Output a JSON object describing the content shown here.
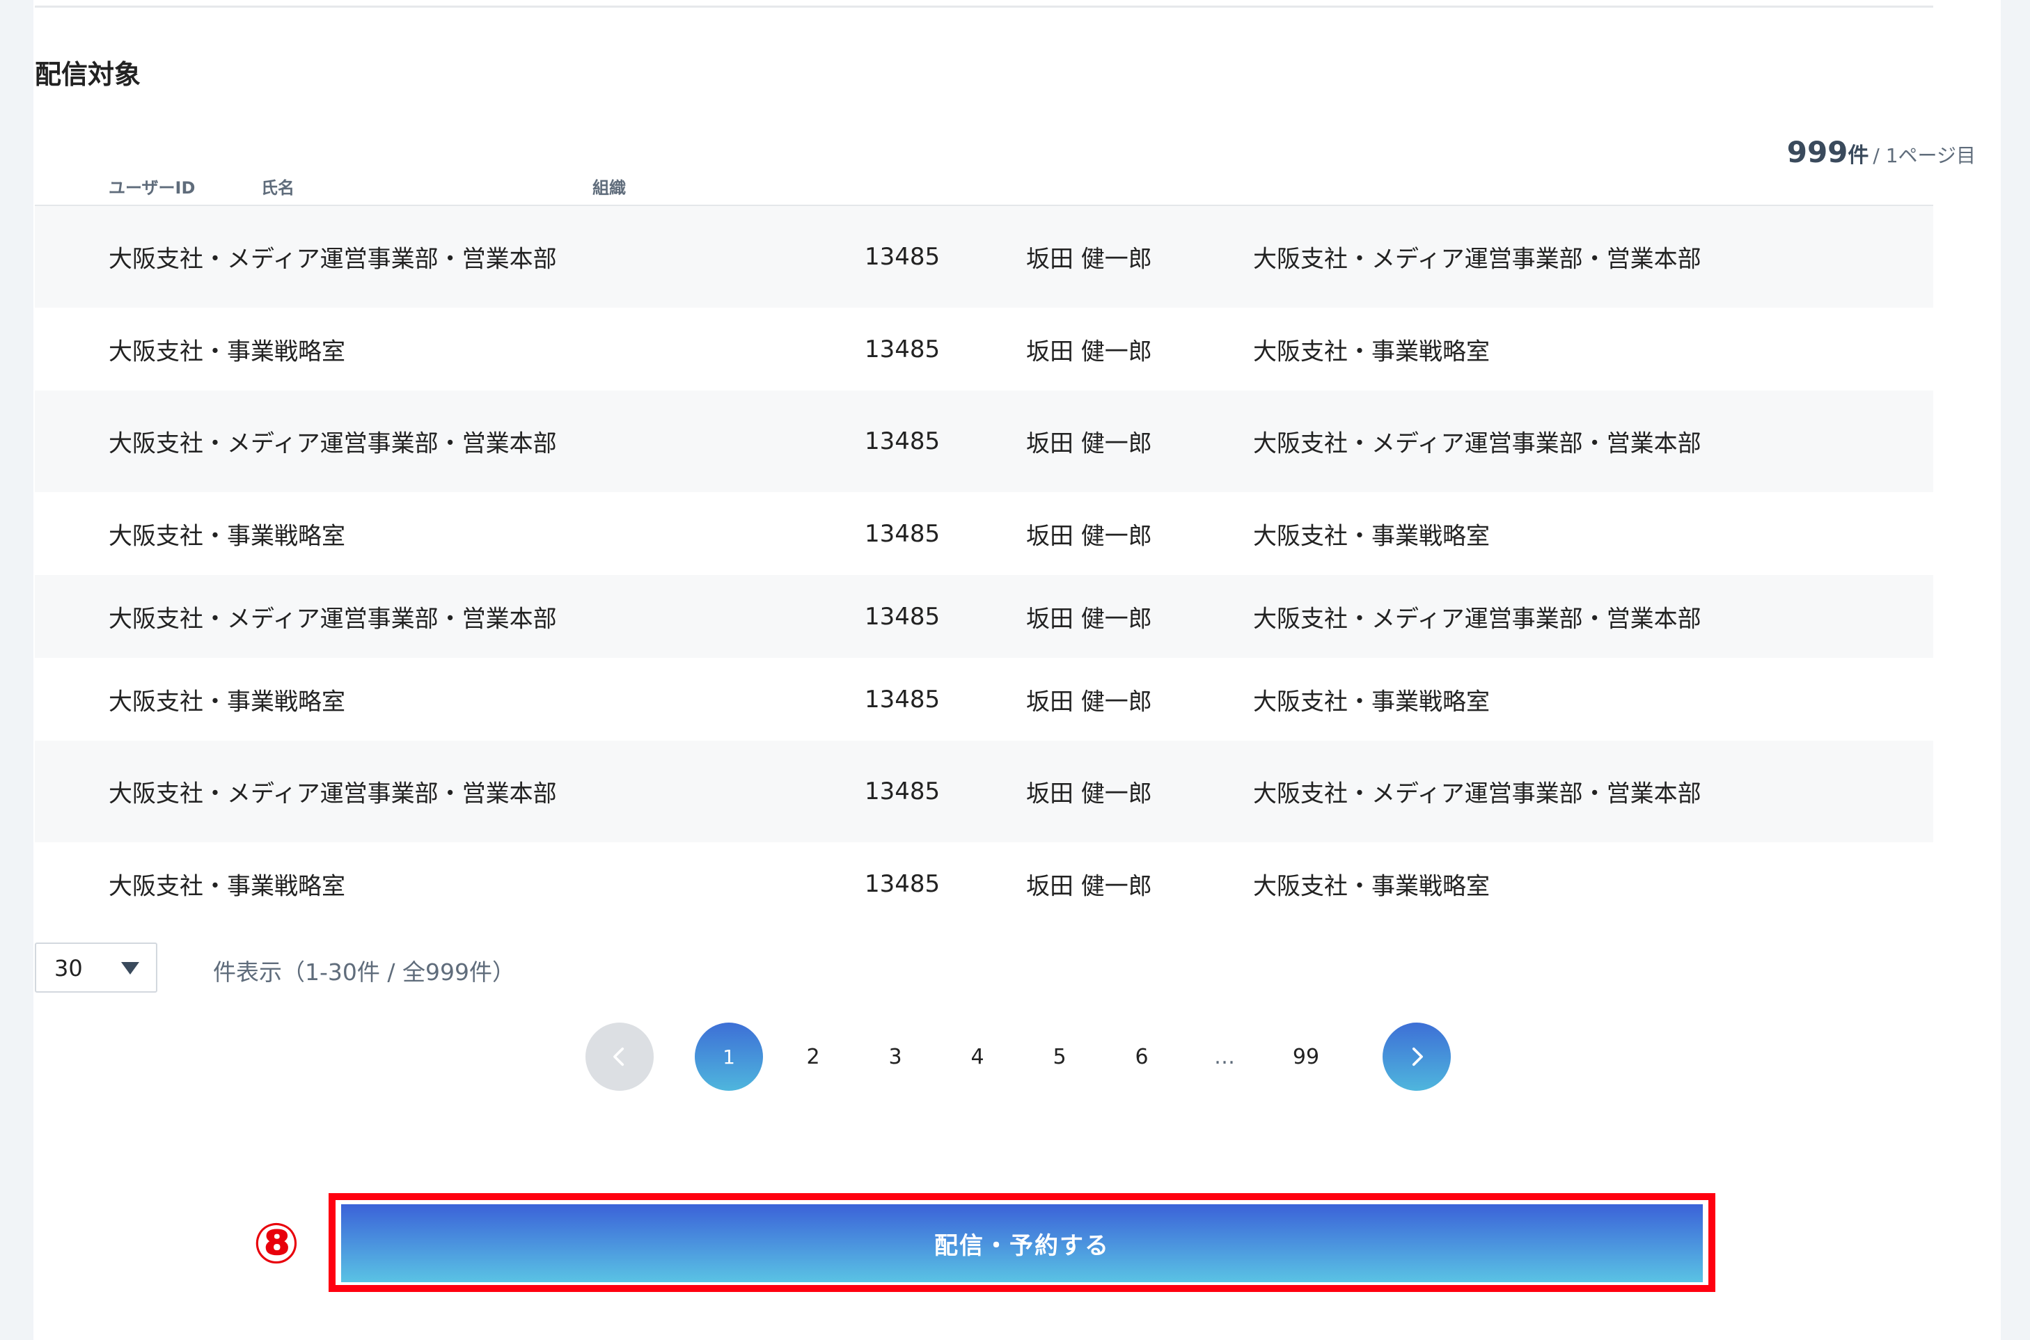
{
  "section": {
    "title": "配信対象"
  },
  "summary": {
    "count": "999",
    "unit": "件",
    "page_info": "/ 1ページ目"
  },
  "columns": [
    "ユーザーID",
    "氏名",
    "組織"
  ],
  "rows": [
    {
      "org_left": "大阪支社・メディア運営事業部・営業本部",
      "id": "13485",
      "name": "坂田 健一郎",
      "org": "大阪支社・メディア運営事業部・営業本部"
    },
    {
      "org_left": "大阪支社・事業戦略室",
      "id": "13485",
      "name": "坂田 健一郎",
      "org": "大阪支社・事業戦略室"
    },
    {
      "org_left": "大阪支社・メディア運営事業部・営業本部",
      "id": "13485",
      "name": "坂田 健一郎",
      "org": "大阪支社・メディア運営事業部・営業本部"
    },
    {
      "org_left": "大阪支社・事業戦略室",
      "id": "13485",
      "name": "坂田 健一郎",
      "org": "大阪支社・事業戦略室"
    },
    {
      "org_left": "大阪支社・メディア運営事業部・営業本部",
      "id": "13485",
      "name": "坂田 健一郎",
      "org": "大阪支社・メディア運営事業部・営業本部"
    },
    {
      "org_left": "大阪支社・事業戦略室",
      "id": "13485",
      "name": "坂田 健一郎",
      "org": "大阪支社・事業戦略室"
    },
    {
      "org_left": "大阪支社・メディア運営事業部・営業本部",
      "id": "13485",
      "name": "坂田 健一郎",
      "org": "大阪支社・メディア運営事業部・営業本部"
    },
    {
      "org_left": "大阪支社・事業戦略室",
      "id": "13485",
      "name": "坂田 健一郎",
      "org": "大阪支社・事業戦略室"
    }
  ],
  "per_page": {
    "value": "30",
    "label": "件表示（1-30件 / 全999件）"
  },
  "pagination": {
    "current": "1",
    "pages": [
      "2",
      "3",
      "4",
      "5",
      "6"
    ],
    "ellipsis": "…",
    "last": "99",
    "prev_icon": "chevron-left-icon",
    "next_icon": "chevron-right-icon"
  },
  "annotation": {
    "badge": "⑧"
  },
  "action": {
    "submit_label": "配信・予約する"
  },
  "colors": {
    "accent_start": "#3b62d8",
    "accent_end": "#5ac3e4",
    "highlight": "#ff0010",
    "badge": "#e8000b"
  }
}
